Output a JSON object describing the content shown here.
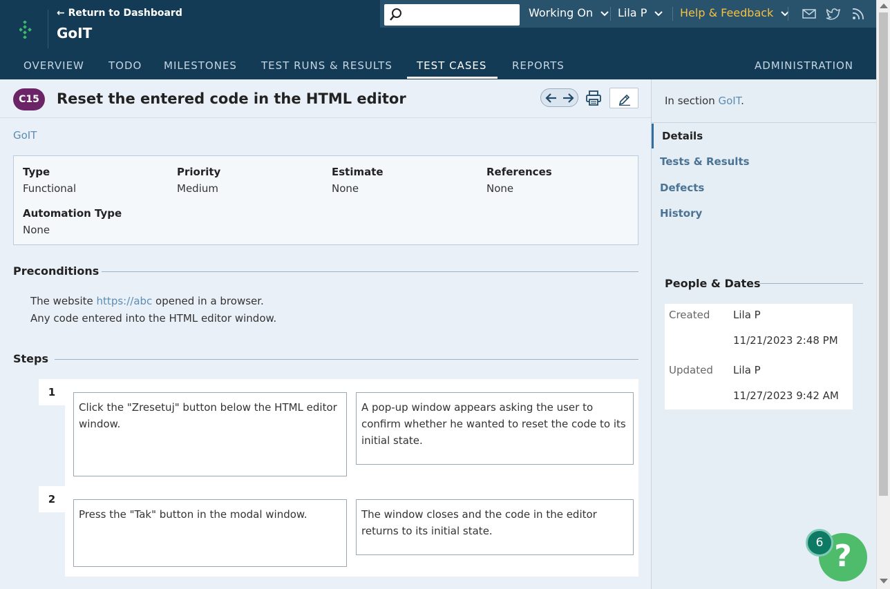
{
  "header": {
    "back_link": "← Return to Dashboard",
    "project_title": "GoIT",
    "search_placeholder": "",
    "working_on": "Working On",
    "user": "Lila P",
    "help": "Help & Feedback"
  },
  "nav": {
    "tabs": [
      "OVERVIEW",
      "TODO",
      "MILESTONES",
      "TEST RUNS & RESULTS",
      "TEST CASES",
      "REPORTS",
      "ADMINISTRATION"
    ],
    "active": "TEST CASES"
  },
  "case": {
    "id": "C15",
    "title": "Reset the entered code in the HTML editor",
    "section": "GoIT",
    "fields": {
      "type_label": "Type",
      "type_value": "Functional",
      "priority_label": "Priority",
      "priority_value": "Medium",
      "estimate_label": "Estimate",
      "estimate_value": "None",
      "references_label": "References",
      "references_value": "None",
      "automation_label": "Automation Type",
      "automation_value": "None"
    },
    "preconditions_header": "Preconditions",
    "preconditions": {
      "line1_prefix": "The website ",
      "line1_link": "https://abc",
      "line1_suffix": " opened in a browser.",
      "line2": "Any code entered into the HTML editor window."
    },
    "steps_header": "Steps",
    "steps": [
      {
        "num": "1",
        "action": "Click the \"Zresetuj\" button below the HTML editor window.",
        "expected": "A pop-up window appears asking the user to confirm whether he wanted to reset the code to its initial state."
      },
      {
        "num": "2",
        "action": "Press the \"Tak\" button in the modal window.",
        "expected": "The window closes and the code in the editor returns to its initial state."
      }
    ]
  },
  "sidebar": {
    "in_section_prefix": "In section ",
    "in_section_link": "GoIT",
    "in_section_suffix": ".",
    "items": [
      "Details",
      "Tests & Results",
      "Defects",
      "History"
    ],
    "active": "Details",
    "people_dates_header": "People & Dates",
    "created_label": "Created",
    "created_by": "Lila P",
    "created_on": "11/21/2023 2:48 PM",
    "updated_label": "Updated",
    "updated_by": "Lila P",
    "updated_on": "11/27/2023 9:42 AM"
  },
  "fab": {
    "label": "?",
    "badge": "6"
  },
  "colors": {
    "header_bg": "#143b55",
    "badge": "#6b2466",
    "link": "#5b8db3",
    "help": "#f5c141",
    "fab": "#4fbc6b"
  }
}
